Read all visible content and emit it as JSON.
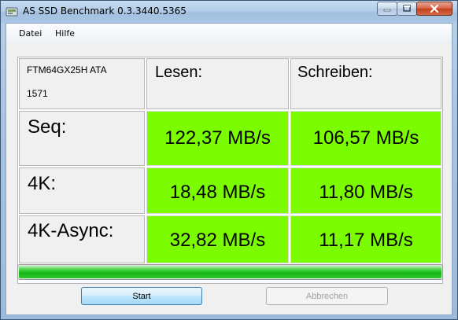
{
  "window": {
    "title": "AS SSD Benchmark 0.3.3440.5365"
  },
  "menu": {
    "file": "Datei",
    "help": "Hilfe"
  },
  "device": {
    "name": "FTM64GX25H ATA",
    "id": "1571"
  },
  "headers": {
    "read": "Lesen:",
    "write": "Schreiben:"
  },
  "rows": [
    {
      "label": "Seq:",
      "read": "122,37 MB/s",
      "write": "106,57 MB/s"
    },
    {
      "label": "4K:",
      "read": "18,48 MB/s",
      "write": "11,80 MB/s"
    },
    {
      "label": "4K-Async:",
      "read": "32,82 MB/s",
      "write": "11,17 MB/s"
    }
  ],
  "progress": {
    "fraction": 1.0
  },
  "buttons": {
    "start": "Start",
    "abort": "Abbrechen"
  },
  "colors": {
    "result_bg": "#7cfc00",
    "progress": "#16b416"
  },
  "icons": {
    "app": "app-icon",
    "minimize": "minimize-icon",
    "maximize": "maximize-icon",
    "close": "close-icon"
  }
}
